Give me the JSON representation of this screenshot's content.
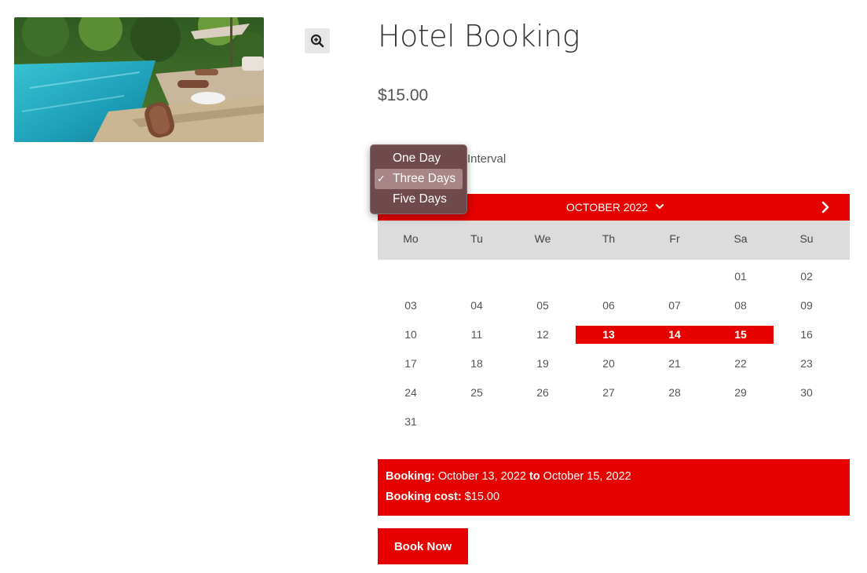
{
  "product": {
    "title": "Hotel Booking",
    "price": "$15.00",
    "image_alt": "hotel pool with sun loungers and towels"
  },
  "interval": {
    "label": "Interval",
    "options": [
      "One Day",
      "Three Days",
      "Five Days"
    ],
    "selected": "Three Days",
    "check_mark": "✓"
  },
  "calendar": {
    "month_label": "OCTOBER 2022",
    "weekdays": [
      "Mo",
      "Tu",
      "We",
      "Th",
      "Fr",
      "Sa",
      "Su"
    ],
    "leading_blanks": 5,
    "days": [
      "01",
      "02",
      "03",
      "04",
      "05",
      "06",
      "07",
      "08",
      "09",
      "10",
      "11",
      "12",
      "13",
      "14",
      "15",
      "16",
      "17",
      "18",
      "19",
      "20",
      "21",
      "22",
      "23",
      "24",
      "25",
      "26",
      "27",
      "28",
      "29",
      "30",
      "31"
    ],
    "selected_days": [
      "13",
      "14",
      "15"
    ]
  },
  "summary": {
    "booking_label": "Booking:",
    "booking_start": "October 13, 2022",
    "booking_to": "to",
    "booking_end": "October 15, 2022",
    "cost_label": "Booking cost:",
    "cost_value": "$15.00"
  },
  "actions": {
    "book_now": "Book Now"
  },
  "colors": {
    "accent": "#e60000",
    "weekday_bg": "#dcdcdc",
    "dropdown_bg": "#6e4a4c"
  }
}
